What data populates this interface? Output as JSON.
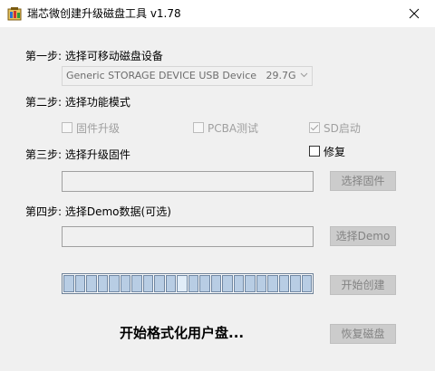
{
  "window": {
    "title": "瑞芯微创建升级磁盘工具 v1.78",
    "close_glyph": "✕"
  },
  "step1": {
    "label": "第一步: 选择可移动磁盘设备",
    "device_value": "Generic STORAGE DEVICE USB Device   29.7G"
  },
  "step2": {
    "label": "第二步: 选择功能模式",
    "options": [
      {
        "label": "固件升级",
        "checked": false
      },
      {
        "label": "PCBA测试",
        "checked": false
      },
      {
        "label": "SD启动",
        "checked": true
      }
    ]
  },
  "step3": {
    "label": "第三步: 选择升级固件",
    "restore_label": "修复",
    "firmware_path": "",
    "select_button": "选择固件"
  },
  "step4": {
    "label": "第四步: 选择Demo数据(可选)",
    "demo_path": "",
    "select_button": "选择Demo"
  },
  "actions": {
    "start_button": "开始创建",
    "restore_disk_button": "恢复磁盘"
  },
  "progress": {
    "segments": 22,
    "highlight_index": 10
  },
  "status_text": "开始格式化用户盘..."
}
